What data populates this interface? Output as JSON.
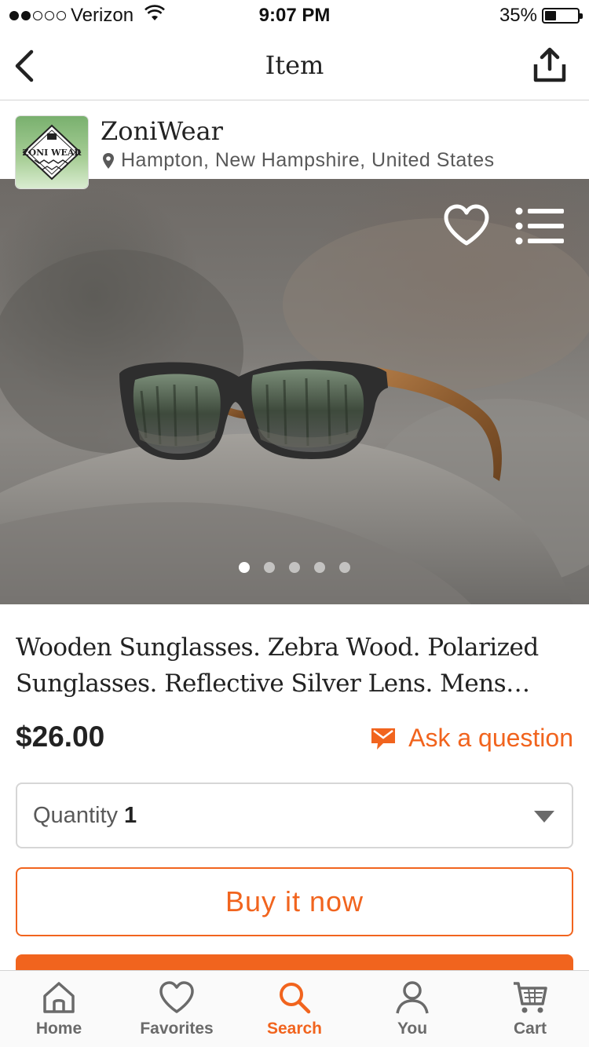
{
  "status_bar": {
    "carrier": "Verizon",
    "time": "9:07 PM",
    "battery_percent": "35%",
    "battery_level": 0.35,
    "signal_bars_filled": 2,
    "signal_bars_total": 5
  },
  "nav": {
    "title": "Item",
    "back_icon": "chevron-left-icon",
    "share_icon": "share-icon"
  },
  "shop": {
    "name": "ZoniWear",
    "location": "Hampton, New Hampshire, United States",
    "logo_text": "ZONI WEAR"
  },
  "hero": {
    "favorite_icon": "heart-outline-icon",
    "lists_icon": "list-icon",
    "image_count": 5,
    "active_image_index": 0
  },
  "item": {
    "title": "Wooden Sunglasses. Zebra Wood. Polarized Sunglasses. Reflective Silver Lens. Mens Sunglasses",
    "price": "$26.00",
    "ask_label": "Ask a question"
  },
  "quantity": {
    "label": "Quantity",
    "value": "1"
  },
  "actions": {
    "buy_now_label": "Buy it now"
  },
  "tabs": [
    {
      "label": "Home",
      "icon": "home-icon",
      "active": false
    },
    {
      "label": "Favorites",
      "icon": "heart-icon",
      "active": false
    },
    {
      "label": "Search",
      "icon": "search-icon",
      "active": true
    },
    {
      "label": "You",
      "icon": "person-icon",
      "active": false
    },
    {
      "label": "Cart",
      "icon": "cart-icon",
      "active": false
    }
  ],
  "colors": {
    "accent": "#f1641e",
    "text": "#222222",
    "muted": "#595959",
    "tab_inactive": "#6a6a6a"
  }
}
